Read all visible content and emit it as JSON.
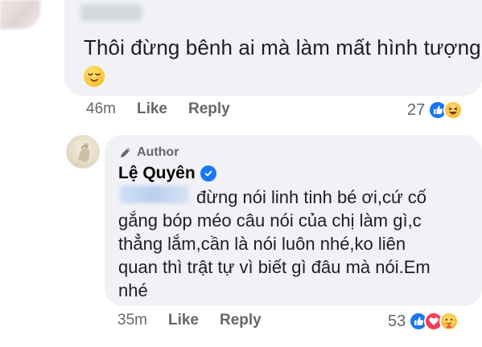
{
  "comment_1": {
    "text": "Thôi đừng bênh ai mà làm mất hình tượng...",
    "emoji": "relieved-face",
    "time": "46m",
    "like_label": "Like",
    "reply_label": "Reply",
    "reaction_count": "27",
    "reactions": [
      "like",
      "haha"
    ]
  },
  "reply": {
    "badge": "Author",
    "name": "Lệ Quyên",
    "verified": true,
    "lines": [
      "đừng nói linh tinh bé ơi,cứ cố",
      "gắng bóp méo câu nói của chị làm gì,c",
      "thẳng lắm,cần là nói luôn nhé,ko liên",
      "quan thì trật tự vì biết gì đâu mà nói.Em",
      "nhé"
    ],
    "time": "35m",
    "like_label": "Like",
    "reply_label": "Reply",
    "reaction_count": "53",
    "reactions": [
      "like",
      "love",
      "care"
    ]
  },
  "colors": {
    "bubble": "#f0f2f5",
    "meta_text": "#65676b",
    "like_blue": "#1877f2",
    "love_red": "#f33e58"
  }
}
